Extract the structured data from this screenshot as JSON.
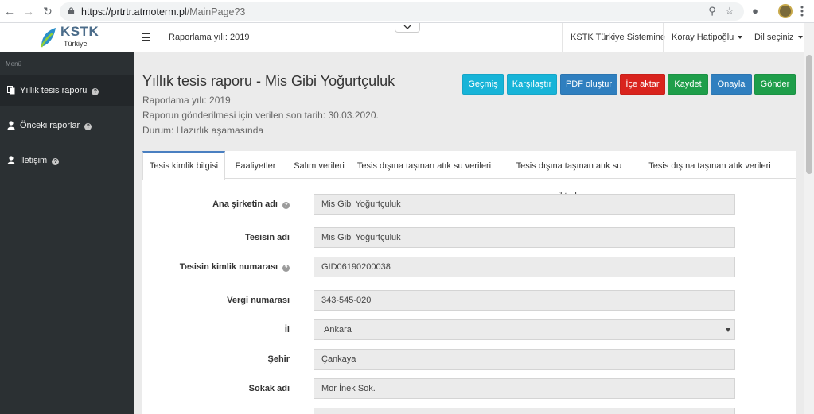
{
  "browser": {
    "url_host": "https://prtrtr.atmoterm.pl",
    "url_path": "/MainPage?3"
  },
  "header": {
    "brand": "KSTK",
    "brand_sub": "Türkiye",
    "reporting_year": "Raporlama yılı: 2019",
    "system_link": "KSTK Türkiye Sistemine",
    "user_name": "Koray Hatipoğlu",
    "language": "Dil seçiniz"
  },
  "sidebar": {
    "header": "Menü",
    "items": [
      {
        "label": "Yıllık tesis raporu",
        "icon": "document-icon"
      },
      {
        "label": "Önceki raporlar",
        "icon": "user-icon"
      },
      {
        "label": "İletişim",
        "icon": "person-icon"
      }
    ]
  },
  "page": {
    "title": "Yıllık tesis raporu - Mis Gibi Yoğurtçuluk",
    "reporting_year": "Raporlama yılı: 2019",
    "deadline": "Raporun gönderilmesi için verilen son tarih: 30.03.2020.",
    "status": "Durum: Hazırlık aşamasında"
  },
  "actions": [
    {
      "label": "Geçmiş",
      "color": "#17b4d8"
    },
    {
      "label": "Karşılaştır",
      "color": "#17b4d8"
    },
    {
      "label": "PDF oluştur",
      "color": "#2f7fbf"
    },
    {
      "label": "İçe aktar",
      "color": "#d9231d"
    },
    {
      "label": "Kaydet",
      "color": "#1e9e4a"
    },
    {
      "label": "Onayla",
      "color": "#2f7fbf"
    },
    {
      "label": "Gönder",
      "color": "#1e9e4a"
    }
  ],
  "tabs": [
    {
      "label": "Tesis kimlik bilgisi"
    },
    {
      "label": "Faaliyetler"
    },
    {
      "label": "Salım verileri"
    },
    {
      "label": "Tesis dışına taşınan atık su verileri"
    },
    {
      "label": "Tesis dışına taşınan atık su miktarları"
    },
    {
      "label": "Tesis dışına taşınan atık verileri"
    }
  ],
  "form": {
    "parent_company_label": "Ana şirketin adı",
    "parent_company_value": "Mis Gibi Yoğurtçuluk",
    "facility_name_label": "Tesisin adı",
    "facility_name_value": "Mis Gibi Yoğurtçuluk",
    "facility_id_label": "Tesisin kimlik numarası",
    "facility_id_value": "GID06190200038",
    "tax_number_label": "Vergi numarası",
    "tax_number_value": "343-545-020",
    "province_label": "İl",
    "province_value": "Ankara",
    "city_label": "Şehir",
    "city_value": "Çankaya",
    "street_label": "Sokak adı",
    "street_value": "Mor İnek Sok."
  }
}
